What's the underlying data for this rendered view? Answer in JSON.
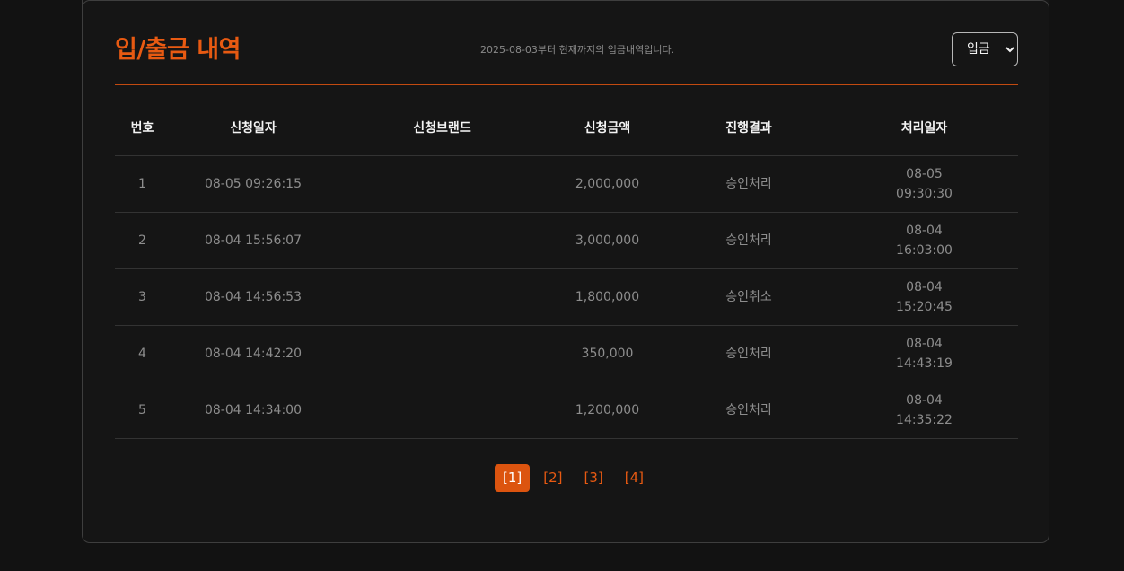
{
  "header": {
    "title": "입/출금 내역",
    "subtitle": "2025-08-03부터 현재까지의 입금내역입니다.",
    "type_select": {
      "selected": "입금"
    }
  },
  "table": {
    "columns": [
      "번호",
      "신청일자",
      "신청브랜드",
      "신청금액",
      "진행결과",
      "처리일자"
    ],
    "rows": [
      {
        "no": "1",
        "date": "08-05 09:26:15",
        "brand": "",
        "amount": "2,000,000",
        "result": "승인처리",
        "proc_date": "08-05",
        "proc_time": "09:30:30"
      },
      {
        "no": "2",
        "date": "08-04 15:56:07",
        "brand": "",
        "amount": "3,000,000",
        "result": "승인처리",
        "proc_date": "08-04",
        "proc_time": "16:03:00"
      },
      {
        "no": "3",
        "date": "08-04 14:56:53",
        "brand": "",
        "amount": "1,800,000",
        "result": "승인취소",
        "proc_date": "08-04",
        "proc_time": "15:20:45"
      },
      {
        "no": "4",
        "date": "08-04 14:42:20",
        "brand": "",
        "amount": "350,000",
        "result": "승인처리",
        "proc_date": "08-04",
        "proc_time": "14:43:19"
      },
      {
        "no": "5",
        "date": "08-04 14:34:00",
        "brand": "",
        "amount": "1,200,000",
        "result": "승인처리",
        "proc_date": "08-04",
        "proc_time": "14:35:22"
      }
    ]
  },
  "pagination": {
    "pages": [
      "[1]",
      "[2]",
      "[3]",
      "[4]"
    ],
    "current": 0
  },
  "colors": {
    "accent": "#e85a12",
    "background": "#121212"
  }
}
